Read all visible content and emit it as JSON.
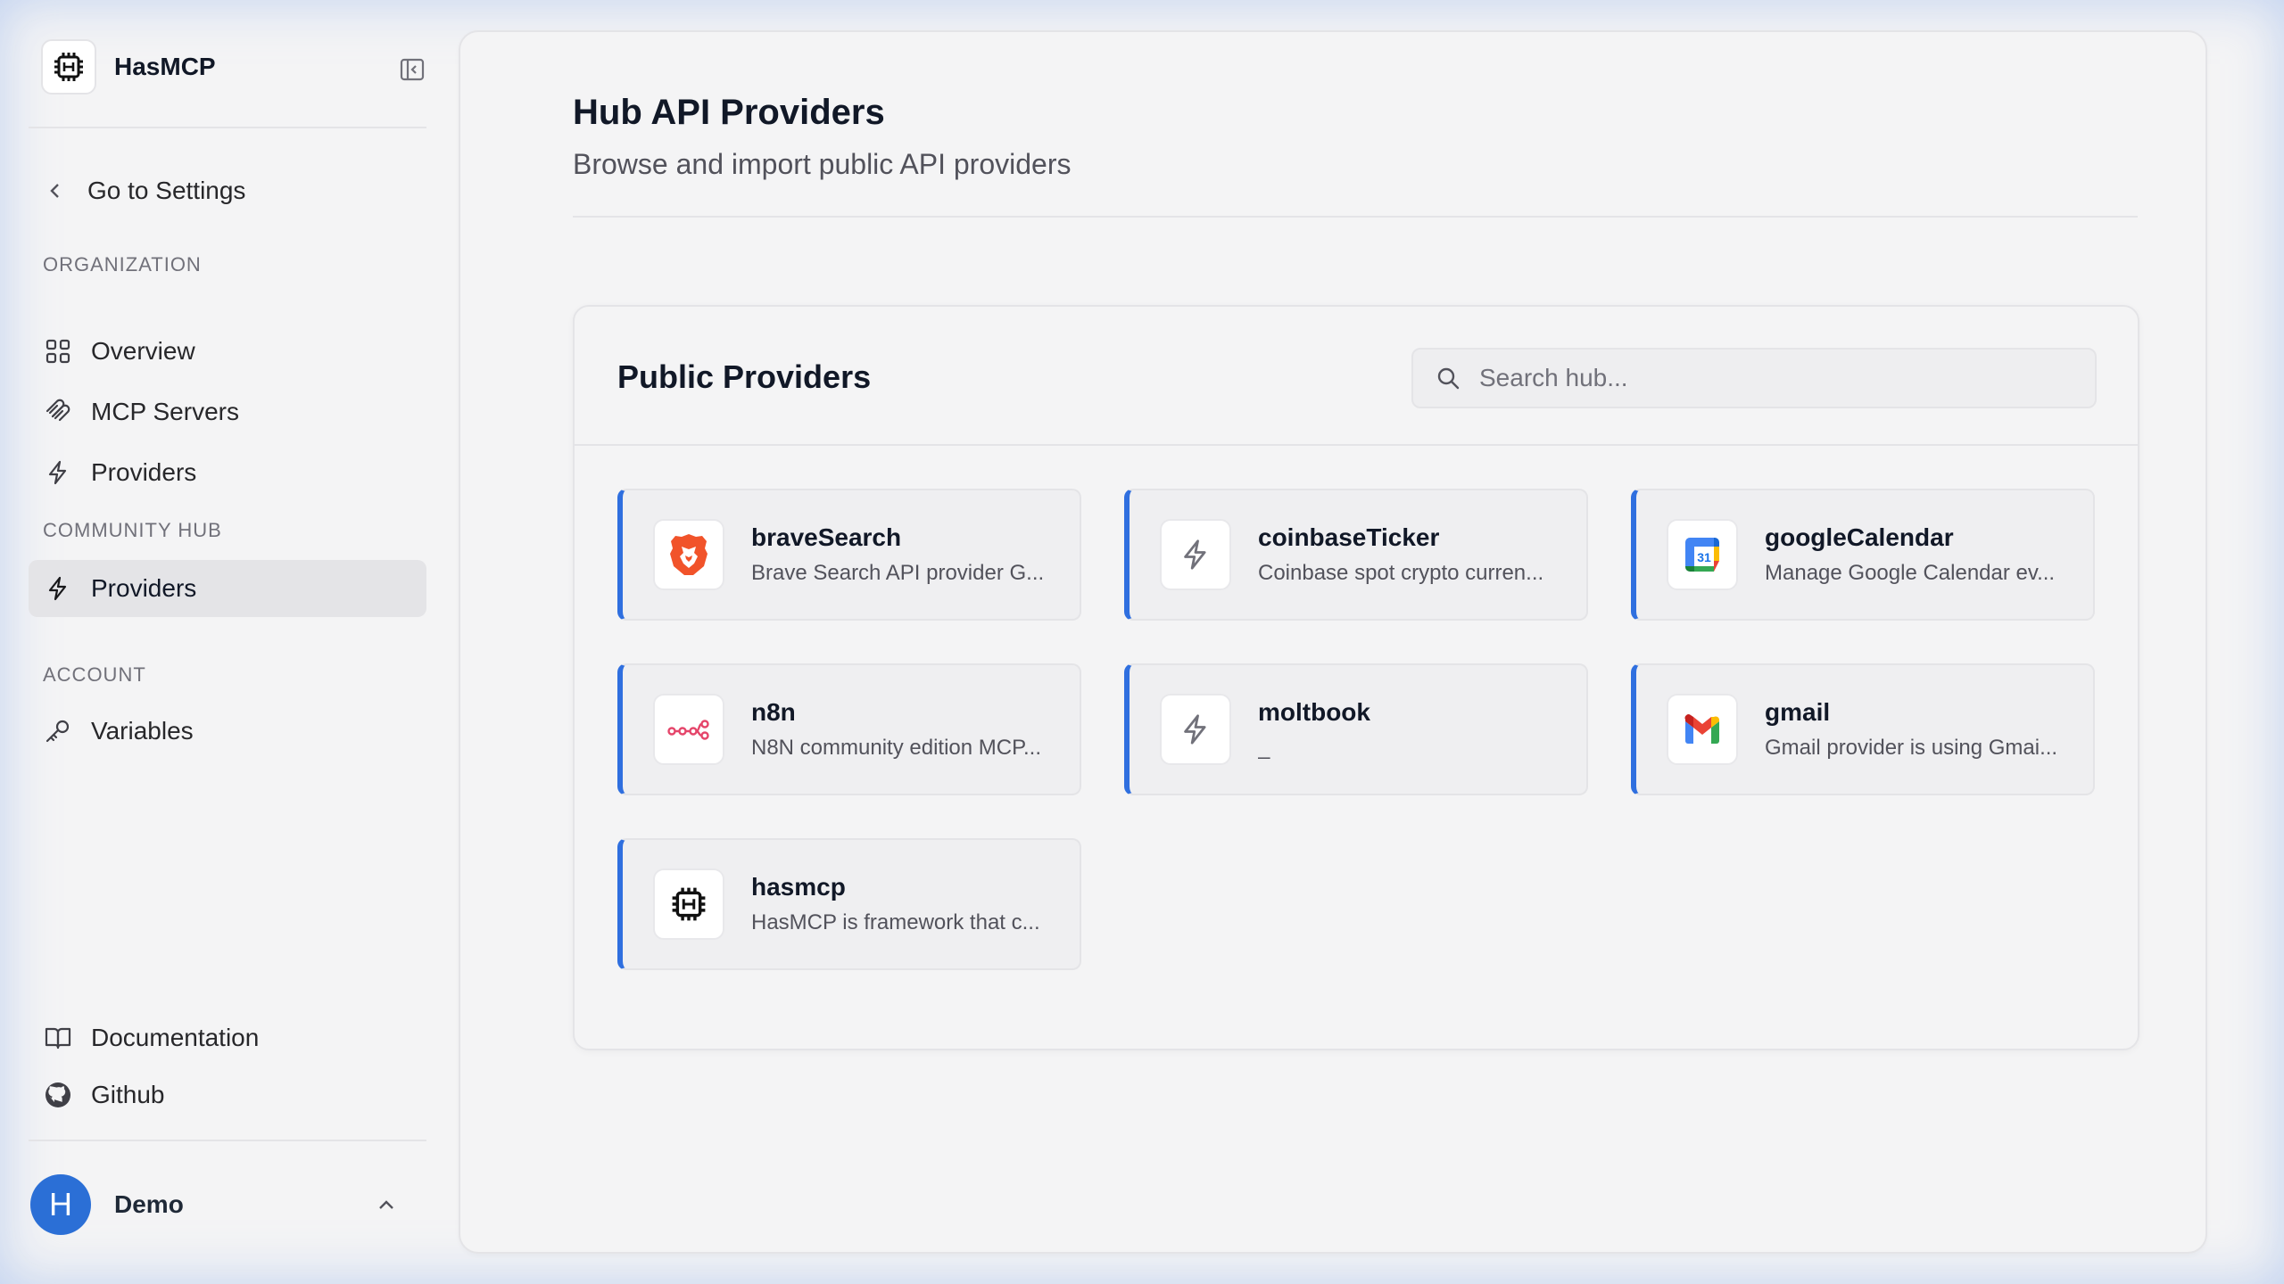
{
  "brand": {
    "name": "HasMCP"
  },
  "nav": {
    "back": "Go to Settings",
    "sections": {
      "organization": "ORGANIZATION",
      "community": "COMMUNITY HUB",
      "account": "ACCOUNT"
    },
    "items": {
      "overview": "Overview",
      "mcp_servers": "MCP Servers",
      "providers": "Providers",
      "hub_providers": "Providers",
      "variables": "Variables",
      "documentation": "Documentation",
      "github": "Github"
    }
  },
  "user": {
    "initial": "H",
    "name": "Demo"
  },
  "page": {
    "title": "Hub API Providers",
    "subtitle": "Browse and import public API providers"
  },
  "panel": {
    "title": "Public Providers",
    "search_placeholder": "Search hub..."
  },
  "providers": [
    {
      "name": "braveSearch",
      "desc": "Brave Search API provider G...",
      "icon": "brave-lion-icon"
    },
    {
      "name": "coinbaseTicker",
      "desc": "Coinbase spot crypto curren...",
      "icon": "bolt-icon"
    },
    {
      "name": "googleCalendar",
      "desc": "Manage Google Calendar ev...",
      "icon": "google-calendar-icon"
    },
    {
      "name": "n8n",
      "desc": "N8N community edition MCP...",
      "icon": "n8n-icon"
    },
    {
      "name": "moltbook",
      "desc": "_",
      "icon": "bolt-icon"
    },
    {
      "name": "gmail",
      "desc": "Gmail provider is using Gmai...",
      "icon": "gmail-icon"
    },
    {
      "name": "hasmcp",
      "desc": "HasMCP is framework that c...",
      "icon": "hasmcp-chip-icon"
    }
  ],
  "colors": {
    "accent": "#2f6fdf",
    "avatar": "#2b6fd6",
    "brave": "#f1532a",
    "n8n": "#e5456a"
  }
}
